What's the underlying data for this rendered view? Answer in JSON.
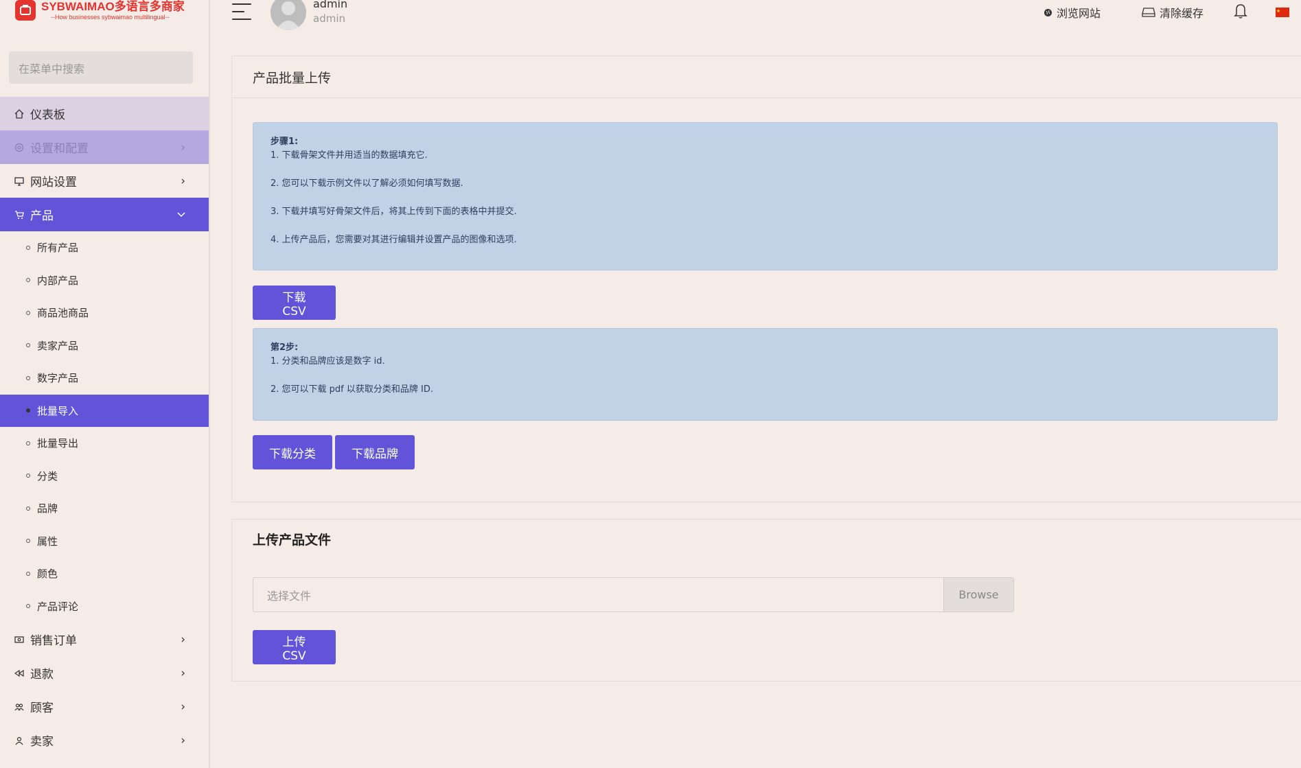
{
  "logo": {
    "brand": "SYBWAIMAO多语言多商家",
    "tagline": "--How businesses sybwaimao multilingual--"
  },
  "sidebar": {
    "search_placeholder": "在菜单中搜索",
    "menu": [
      {
        "label": "仪表板",
        "icon": "home-icon"
      },
      {
        "label": "设置和配置",
        "icon": "gear-icon"
      },
      {
        "label": "网站设置",
        "icon": "monitor-icon"
      },
      {
        "label": "产品",
        "icon": "cart-icon"
      }
    ],
    "product_sub": [
      "所有产品",
      "内部产品",
      "商品池商品",
      "卖家产品",
      "数字产品",
      "批量导入",
      "批量导出",
      "分类",
      "品牌",
      "属性",
      "颜色",
      "产品评论"
    ],
    "menu_after": [
      {
        "label": "销售订单",
        "icon": "money-icon"
      },
      {
        "label": "退款",
        "icon": "backward-icon"
      },
      {
        "label": "顾客",
        "icon": "users-icon"
      },
      {
        "label": "卖家",
        "icon": "user-icon"
      }
    ]
  },
  "topbar": {
    "user_name": "admin",
    "user_role": "admin",
    "browse_site": "浏览网站",
    "clear_cache": "清除缓存"
  },
  "bulk_upload": {
    "title": "产品批量上传",
    "step1_title": "步骤1:",
    "step1_lines": [
      "1. 下载骨架文件并用适当的数据填充它.",
      "2. 您可以下载示例文件以了解必须如何填写数据.",
      "3. 下载并填写好骨架文件后，将其上传到下面的表格中并提交.",
      "4. 上传产品后，您需要对其进行编辑并设置产品的图像和选项."
    ],
    "download_csv": "下载 CSV",
    "step2_title": "第2步:",
    "step2_lines": [
      "1. 分类和品牌应该是数字 id.",
      "2. 您可以下载 pdf 以获取分类和品牌 ID."
    ],
    "download_category": "下载分类",
    "download_brand": "下载品牌"
  },
  "upload_file": {
    "title": "上传产品文件",
    "file_placeholder": "选择文件",
    "browse": "Browse",
    "upload_csv": "上传 CSV"
  },
  "colors": {
    "accent": "#6254d8",
    "background": "#f5ebe7",
    "alert": "#c2d2e6",
    "logo_red": "#e3342f"
  }
}
